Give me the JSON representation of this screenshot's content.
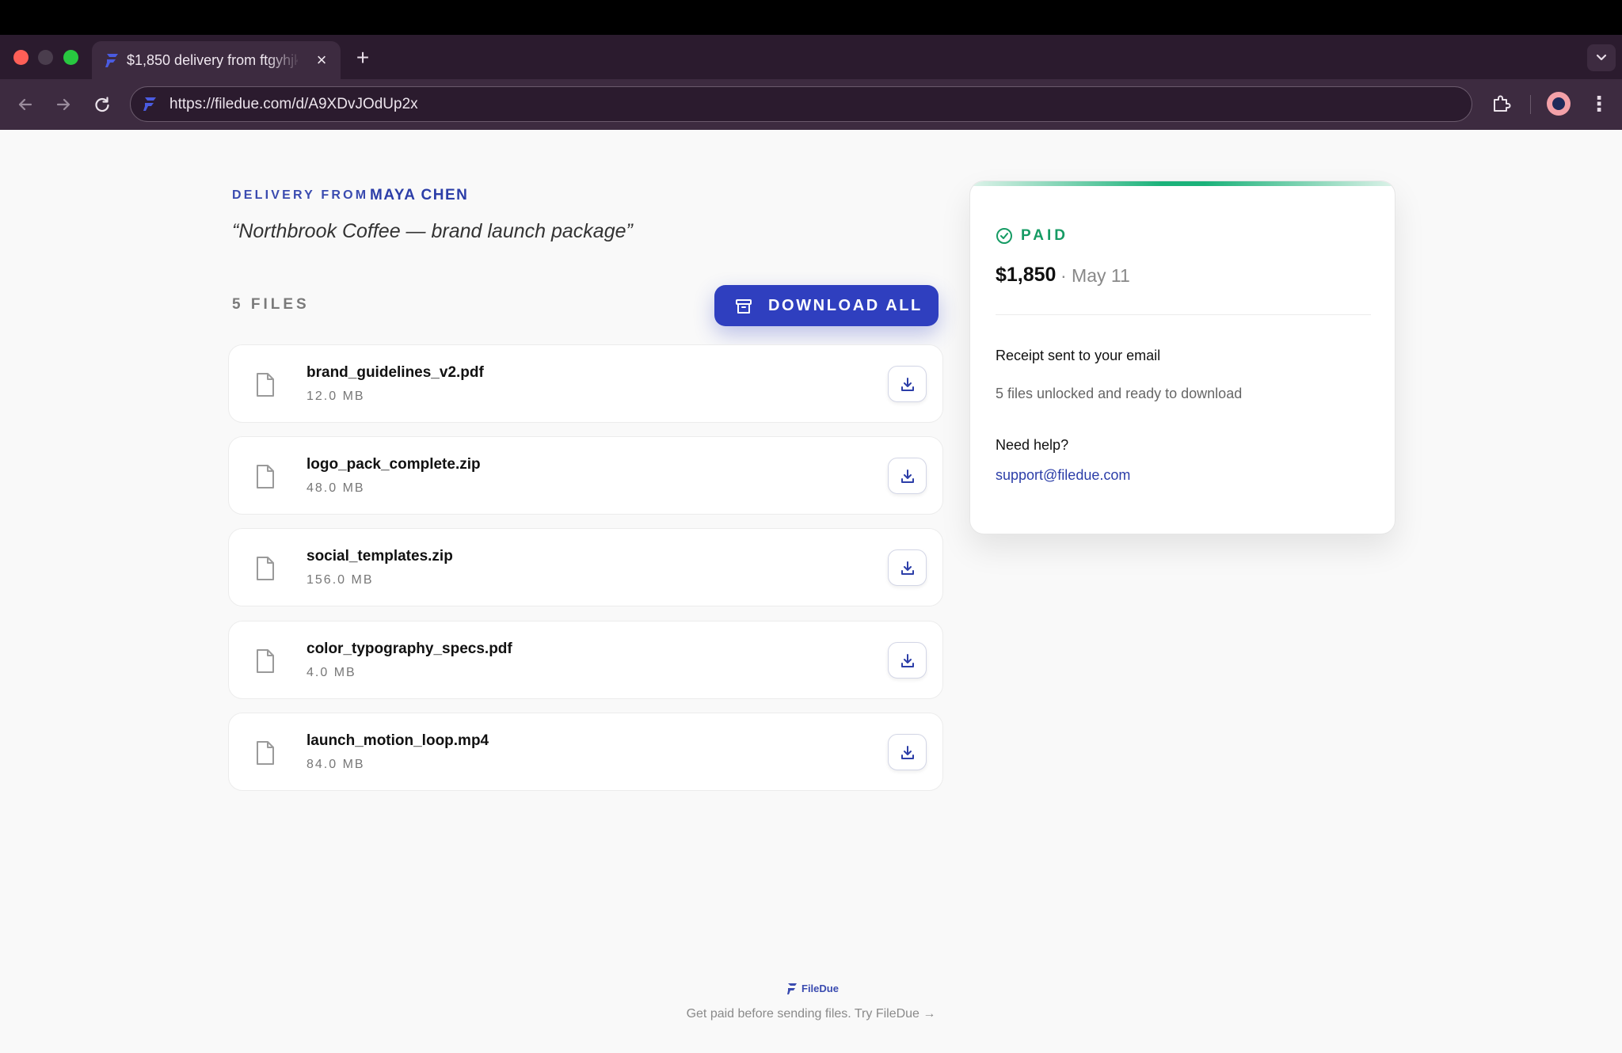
{
  "browser": {
    "tab_title": "$1,850 delivery from ftgyhjk",
    "url": "https://filedue.com/d/A9XDvJOdUp2x",
    "new_tab": "+",
    "close_tab": "×"
  },
  "delivery": {
    "eyebrow": "DELIVERY FROM",
    "sender": "MAYA CHEN",
    "project_title": "“Northbrook Coffee — brand launch package”"
  },
  "files": {
    "count_label": "5 FILES",
    "download_all_label": "DOWNLOAD ALL",
    "items": [
      {
        "name": "brand_guidelines_v2.pdf",
        "size": "12.0 MB"
      },
      {
        "name": "logo_pack_complete.zip",
        "size": "48.0 MB"
      },
      {
        "name": "social_templates.zip",
        "size": "156.0 MB"
      },
      {
        "name": "color_typography_specs.pdf",
        "size": "4.0 MB"
      },
      {
        "name": "launch_motion_loop.mp4",
        "size": "84.0 MB"
      }
    ]
  },
  "payment": {
    "status": "PAID",
    "amount": "$1,850",
    "date": "· May 11",
    "receipt_text": "Receipt sent to your email",
    "unlocked_text": "5 files unlocked and ready to download",
    "help_label": "Need help?",
    "support_email": "support@filedue.com"
  },
  "footer": {
    "brand": "FileDue",
    "tagline": "Get paid before sending files. Try FileDue →"
  },
  "colors": {
    "accent": "#2f3fbf",
    "paid_green": "#169b64",
    "chrome_bg": "#3d2b40"
  }
}
